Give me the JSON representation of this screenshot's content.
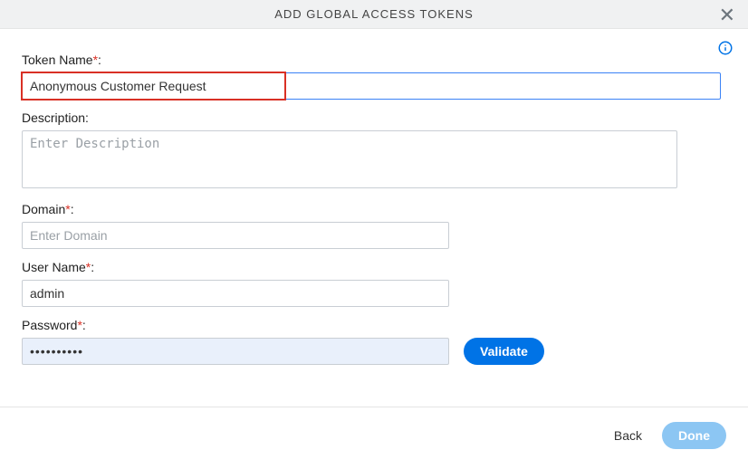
{
  "title": "ADD GLOBAL ACCESS TOKENS",
  "form": {
    "tokenName": {
      "label": "Token Name",
      "required": "*",
      "colon": ":",
      "value": "Anonymous Customer Request"
    },
    "description": {
      "label": "Description:",
      "placeholder": "Enter Description",
      "value": ""
    },
    "domain": {
      "label": "Domain",
      "required": "*",
      "colon": ":",
      "placeholder": "Enter Domain",
      "value": ""
    },
    "username": {
      "label": "User Name",
      "required": "*",
      "colon": ":",
      "value": "admin"
    },
    "password": {
      "label": "Password",
      "required": "*",
      "colon": ":",
      "value": "••••••••••"
    },
    "validate": "Validate"
  },
  "footer": {
    "back": "Back",
    "done": "Done"
  }
}
